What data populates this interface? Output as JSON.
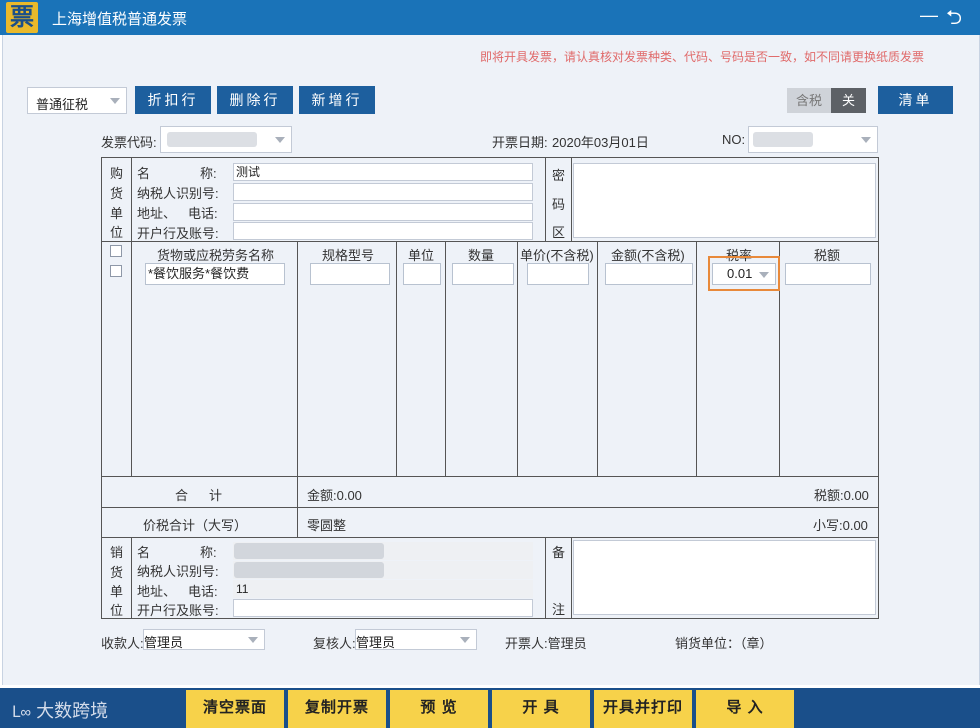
{
  "titlebar": {
    "title": "上海增值税普通发票",
    "logo": "票"
  },
  "notice": "即将开具发票，请认真核对发票种类、代码、号码是否一致，如不同请更换纸质发票",
  "toolbar": {
    "tax_type": "普通征税",
    "discount_row": "折扣行",
    "delete_row": "删除行",
    "add_row": "新增行",
    "tax_included_label": "含税",
    "tax_included_state": "关",
    "clear_list": "清单"
  },
  "invoice_info": {
    "code_label": "发票代码:",
    "date_label": "开票日期:",
    "date_value": "2020年03月01日",
    "no_label": "NO:"
  },
  "buyer": {
    "section_chars": [
      "购",
      "货",
      "单",
      "位"
    ],
    "name_label_a": "名",
    "name_label_b": "称:",
    "name_value": "测试",
    "taxid_label": "纳税人识别号:",
    "address_label_a": "地址、",
    "address_label_b": "电话:",
    "bank_label": "开户行及账号:",
    "cipher_chars": [
      "密",
      "码",
      "区"
    ]
  },
  "items": {
    "headers": [
      "货物或应税劳务名称",
      "规格型号",
      "单位",
      "数量",
      "单价(不含税)",
      "金额(不含税)",
      "税率",
      "税额"
    ],
    "row": {
      "name": "*餐饮服务*餐饮费",
      "tax_rate": "0.01"
    }
  },
  "totals": {
    "label_a": "合",
    "label_b": "计",
    "amount": "金额:0.00",
    "tax": "税额:0.00",
    "total_label": "价税合计（大写）",
    "total_upper": "零圆整",
    "total_lower": "小写:0.00"
  },
  "seller": {
    "section_chars": [
      "销",
      "货",
      "单",
      "位"
    ],
    "name_label_a": "名",
    "name_label_b": "称:",
    "taxid_label": "纳税人识别号:",
    "address_label_a": "地址、",
    "address_label_b": "电话:",
    "address_value": "11",
    "bank_label": "开户行及账号:",
    "note_chars": [
      "备",
      "注"
    ]
  },
  "signatures": {
    "payee_label": "收款人:",
    "payee_value": "管理员",
    "reviewer_label": "复核人:",
    "reviewer_value": "管理员",
    "drawer": "开票人:管理员",
    "seller_seal": "销货单位：（章）"
  },
  "actions": {
    "brand": "大数跨境",
    "clear_form": "清空票面",
    "copy_invoice": "复制开票",
    "preview": "预 览",
    "issue": "开 具",
    "issue_print": "开具并打印",
    "import": "导 入"
  },
  "colors": {
    "title_bar": "#1a73b8",
    "panel": "#eef2f8",
    "button": "#1d5f9e",
    "action_button": "#f7d24a",
    "notice": "#e06a6a",
    "highlight": "#e8893a"
  }
}
